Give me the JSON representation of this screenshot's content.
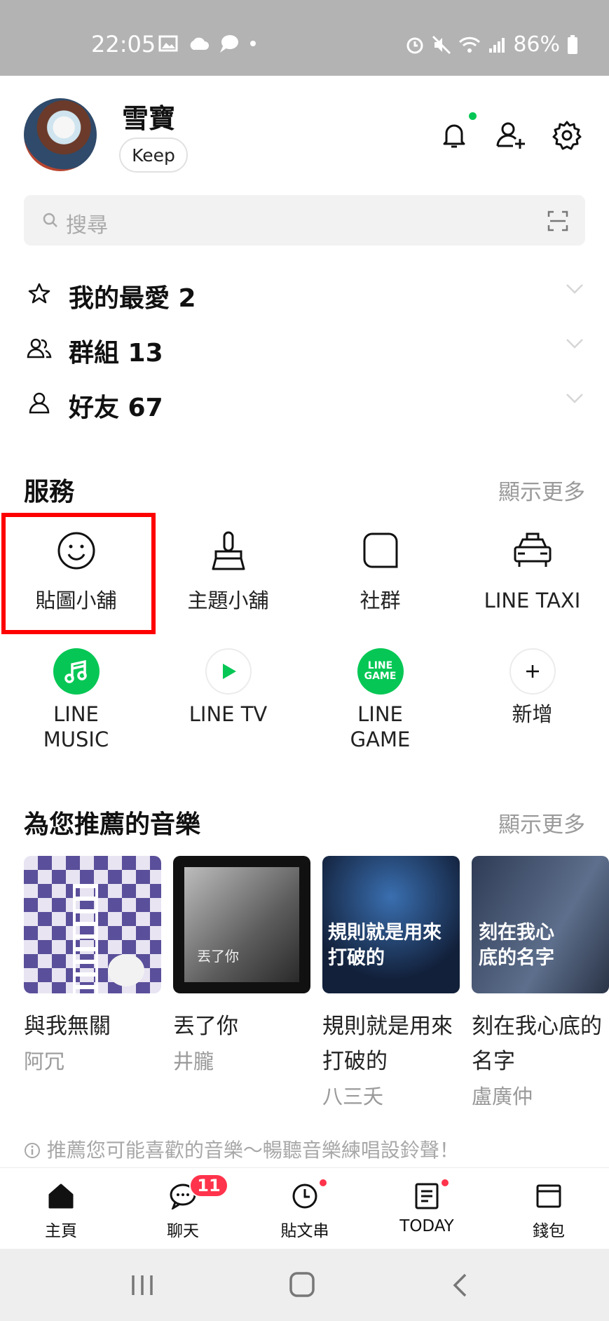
{
  "status_bar": {
    "time": "22:05",
    "battery": "86%"
  },
  "profile": {
    "name": "雪寶",
    "keep_label": "Keep"
  },
  "search": {
    "placeholder": "搜尋"
  },
  "lists": [
    {
      "label": "我的最愛 2",
      "icon": "star-icon"
    },
    {
      "label": "群組 13",
      "icon": "group-icon"
    },
    {
      "label": "好友 67",
      "icon": "person-icon"
    }
  ],
  "services": {
    "title": "服務",
    "more_label": "顯示更多",
    "items": [
      {
        "label": "貼圖小舖",
        "icon": "smiley-icon"
      },
      {
        "label": "主題小舖",
        "icon": "brush-icon"
      },
      {
        "label": "社群",
        "icon": "chat-bubble-icon"
      },
      {
        "label": "LINE TAXI",
        "icon": "taxi-icon"
      },
      {
        "label": "LINE\nMUSIC",
        "icon": "music-note-icon"
      },
      {
        "label": "LINE TV",
        "icon": "play-icon"
      },
      {
        "label": "LINE\nGAME",
        "icon": "line-game-icon",
        "icon_text": "LINE\nGAME"
      },
      {
        "label": "新增",
        "icon": "plus-icon"
      }
    ]
  },
  "music": {
    "title": "為您推薦的音樂",
    "more_label": "顯示更多",
    "items": [
      {
        "title": "與我無關",
        "artist": "阿冗",
        "album_text": ""
      },
      {
        "title": "丟了你",
        "artist": "井朧",
        "album_text": "丟了你"
      },
      {
        "title": "規則就是用來打破的",
        "artist": "八三夭",
        "album_text": "規則就是用來打破的"
      },
      {
        "title": "刻在我心底的名字",
        "artist": "盧廣仲",
        "album_text": "刻在我心底的名字"
      }
    ],
    "hint": "推薦您可能喜歡的音樂～暢聽音樂練唱設鈴聲！"
  },
  "tabs": [
    {
      "label": "主頁",
      "icon": "home-icon"
    },
    {
      "label": "聊天",
      "icon": "chat-icon",
      "badge": "11"
    },
    {
      "label": "貼文串",
      "icon": "clock-icon"
    },
    {
      "label": "TODAY",
      "icon": "news-icon"
    },
    {
      "label": "錢包",
      "icon": "wallet-icon"
    }
  ],
  "colors": {
    "accent_green": "#06c755",
    "badge_red": "#ff334b",
    "highlight_red": "#ff0000"
  }
}
